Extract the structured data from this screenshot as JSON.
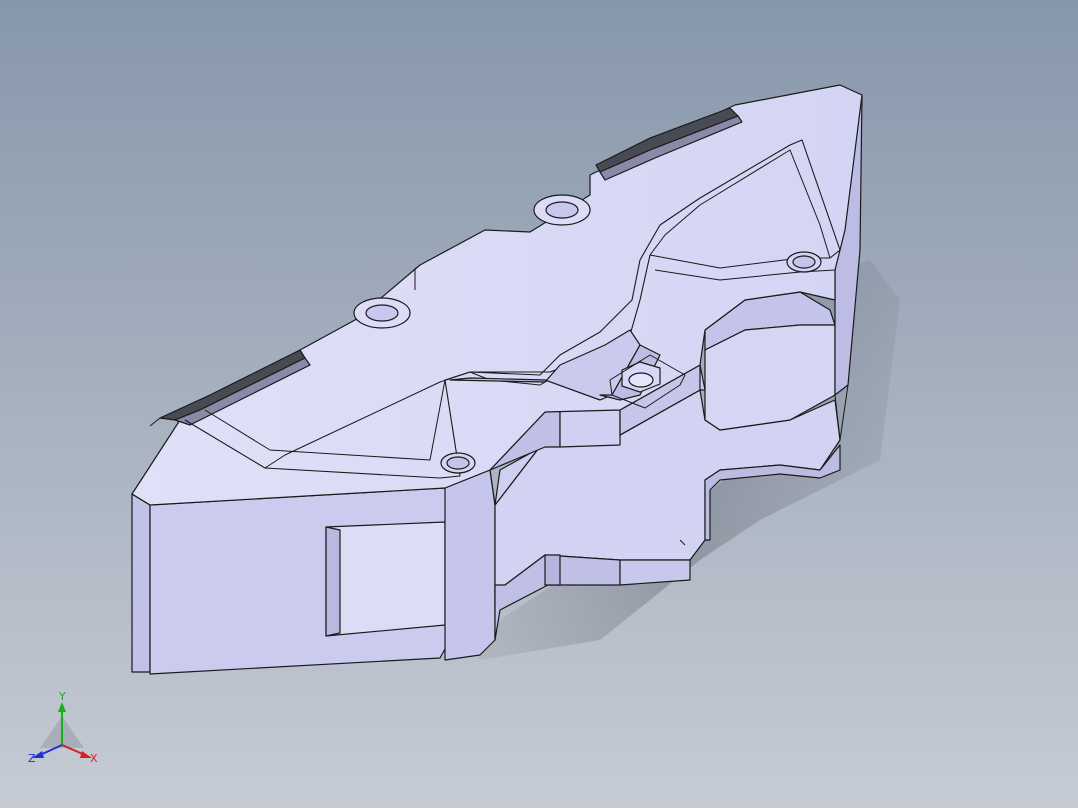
{
  "viewport": {
    "background_top": "#8797ab",
    "background_bottom": "#c6cbd4",
    "model_face_color": "#d9d9f5",
    "model_side_color": "#c4c4ea",
    "model_edge_color": "#1a1a1a",
    "model_shadow_color": "#50545e"
  },
  "triad": {
    "x_label": "X",
    "y_label": "Y",
    "z_label": "Z",
    "x_color": "#d62020",
    "y_color": "#18b018",
    "z_color": "#2030d8"
  }
}
